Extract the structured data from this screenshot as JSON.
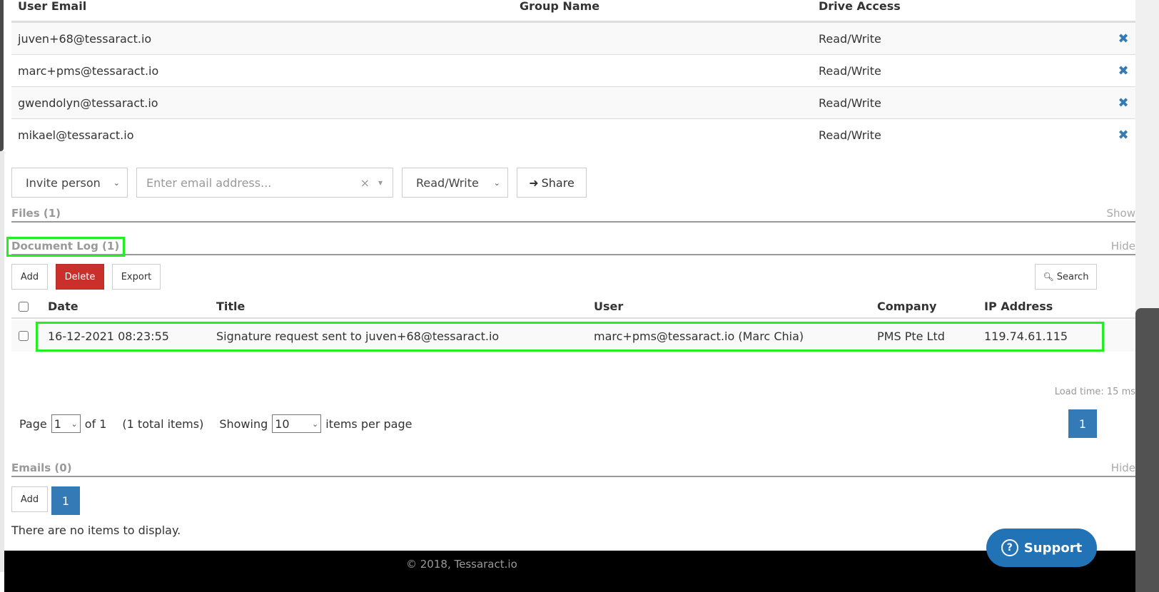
{
  "users_table": {
    "headers": {
      "email": "User Email",
      "group": "Group Name",
      "access": "Drive Access"
    },
    "rows": [
      {
        "email": "juven+68@tessaract.io",
        "group": "",
        "access": "Read/Write",
        "remove_icon": "remove-x-icon"
      },
      {
        "email": "marc+pms@tessaract.io",
        "group": "",
        "access": "Read/Write",
        "remove_icon": "remove-x-icon"
      },
      {
        "email": "gwendolyn@tessaract.io",
        "group": "",
        "access": "Read/Write",
        "remove_icon": "remove-x-icon"
      },
      {
        "email": "mikael@tessaract.io",
        "group": "",
        "access": "Read/Write",
        "remove_icon": "remove-x-icon"
      }
    ],
    "remove_glyph": "✖"
  },
  "invite": {
    "type_select": "Invite person",
    "email_placeholder": "Enter email address...",
    "clear_glyph": "×",
    "dropdown_glyph": "▾",
    "access_select": "Read/Write",
    "share_label": "Share",
    "share_glyph": "➜",
    "chevron_glyph": "⌄"
  },
  "files_section": {
    "title": "Files (1)",
    "toggle": "Show"
  },
  "doc_log_section": {
    "title": "Document Log (1)",
    "toggle": "Hide",
    "toolbar": {
      "add": "Add",
      "delete": "Delete",
      "export": "Export",
      "search": "Search",
      "search_glyph": "🔍"
    },
    "headers": {
      "date": "Date",
      "title": "Title",
      "user": "User",
      "company": "Company",
      "ip": "IP Address"
    },
    "rows": [
      {
        "date": "16-12-2021 08:23:55",
        "title": "Signature request sent to juven+68@tessaract.io",
        "user": "marc+pms@tessaract.io (Marc Chia)",
        "company": "PMS Pte Ltd",
        "ip": "119.74.61.115"
      }
    ],
    "load_time": "Load time: 15 ms",
    "pager": {
      "page_label": "Page",
      "page_value": "1",
      "of_label": "of 1",
      "total_label": "(1 total items)",
      "showing_label": "Showing",
      "per_page_value": "10",
      "per_page_label": "items per page",
      "current_page": "1"
    }
  },
  "emails_section": {
    "title": "Emails (0)",
    "toggle": "Hide",
    "add": "Add",
    "current_page": "1",
    "empty_text": "There are no items to display."
  },
  "footer": {
    "text": "© 2018, Tessaract.io"
  },
  "support": {
    "label": "Support",
    "glyph": "?"
  },
  "colors": {
    "primary": "#337ab7",
    "danger": "#c9302c",
    "support": "#2272b6",
    "highlight": "#22ee22",
    "section_title": "#999999"
  }
}
